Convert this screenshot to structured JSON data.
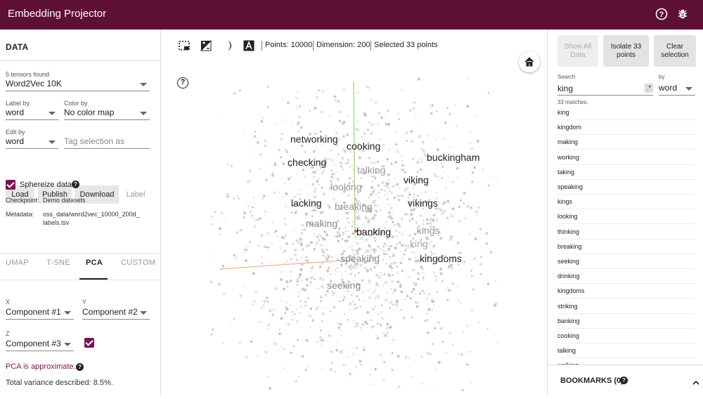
{
  "header": {
    "title": "Embedding Projector"
  },
  "left_panel": {
    "heading": "DATA",
    "tensors_label": "5 tensors found",
    "tensor_select": "Word2Vec 10K",
    "label_by": {
      "label": "Label by",
      "value": "word"
    },
    "color_by": {
      "label": "Color by",
      "value": "No color map"
    },
    "edit_by": {
      "label": "Edit by",
      "value": "word"
    },
    "tag_placeholder": "Tag selection as",
    "buttons": {
      "load": "Load",
      "publish": "Publish",
      "download": "Download",
      "label": "Label"
    },
    "sphereize": "Sphereize data",
    "checkpoint_label": "Checkpoint:",
    "checkpoint_value": "Demo datasets",
    "metadata_label": "Metadata:",
    "metadata_value_1": "oss_data/word2vec_10000_200d_",
    "metadata_value_2": "labels.tsv",
    "tabs": [
      "UMAP",
      "T-SNE",
      "PCA",
      "CUSTOM"
    ],
    "x_axis": {
      "label": "X",
      "value": "Component #1"
    },
    "y_axis": {
      "label": "Y",
      "value": "Component #2"
    },
    "z_axis": {
      "label": "Z",
      "value": "Component #3"
    },
    "pca_note": "PCA is approximate.",
    "variance": "Total variance described: 8.5%."
  },
  "toolbar": {
    "points": "Points: 10000",
    "dimension": "Dimension: 200",
    "selected": "Selected 33 points"
  },
  "canvas_labels": [
    {
      "text": "networking",
      "shade": "#222"
    },
    {
      "text": "cooking",
      "shade": "#222"
    },
    {
      "text": "buckingham",
      "shade": "#222"
    },
    {
      "text": "checking",
      "shade": "#222"
    },
    {
      "text": "talking",
      "shade": "#999"
    },
    {
      "text": "viking",
      "shade": "#222"
    },
    {
      "text": "looking",
      "shade": "#999"
    },
    {
      "text": "lacking",
      "shade": "#222"
    },
    {
      "text": "breaking",
      "shade": "#999"
    },
    {
      "text": "vikings",
      "shade": "#222"
    },
    {
      "text": "making",
      "shade": "#888"
    },
    {
      "text": "banking",
      "shade": "#111"
    },
    {
      "text": "kings",
      "shade": "#999"
    },
    {
      "text": "king",
      "shade": "#aaa"
    },
    {
      "text": "speaking",
      "shade": "#888"
    },
    {
      "text": "kingdoms",
      "shade": "#222"
    },
    {
      "text": "seeking",
      "shade": "#888"
    }
  ],
  "right_panel": {
    "show_all": "Show All Data",
    "isolate": "Isolate 33 points",
    "clear": "Clear selection",
    "search_label": "Search",
    "search_value": "king",
    "regex": ".*",
    "by_label": "by",
    "by_value": "word",
    "matches": "33 matches.",
    "results": [
      "king",
      "kingdom",
      "making",
      "working",
      "taking",
      "speaking",
      "kings",
      "looking",
      "thinking",
      "breaking",
      "seeking",
      "drinking",
      "kingdoms",
      "striking",
      "banking",
      "cooking",
      "talking",
      "walking"
    ],
    "bookmarks": "BOOKMARKS (0)"
  },
  "colors": {
    "header": "#5e0f34",
    "accent": "#7b1452"
  }
}
